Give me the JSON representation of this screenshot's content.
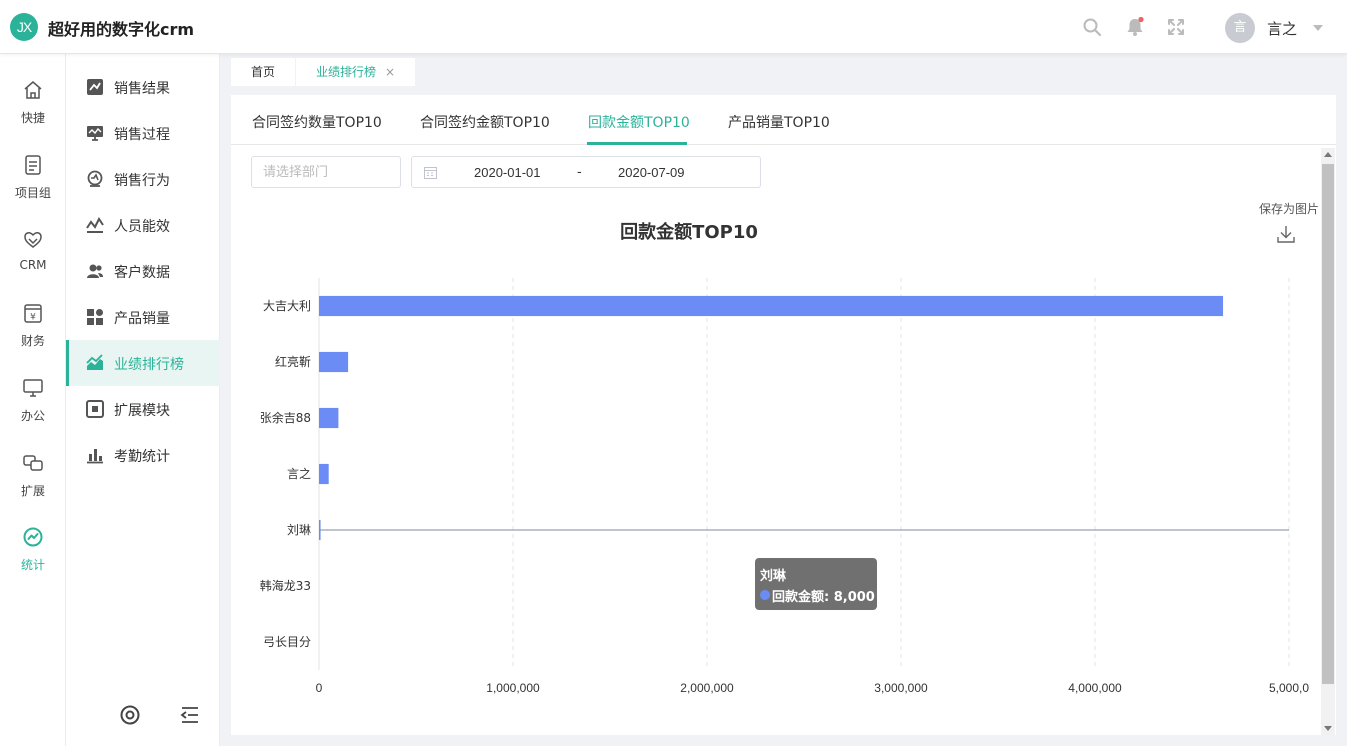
{
  "app": {
    "logo_text": "JX",
    "title": "超好用的数字化crm"
  },
  "header": {
    "icons": [
      "search-icon",
      "bell-icon",
      "fullscreen-icon"
    ],
    "avatar_text": "言",
    "user_name": "言之"
  },
  "rail": {
    "items": [
      {
        "label": "快捷",
        "icon": "home-icon"
      },
      {
        "label": "项目组",
        "icon": "document-icon"
      },
      {
        "label": "CRM",
        "icon": "handshake-icon"
      },
      {
        "label": "财务",
        "icon": "finance-icon"
      },
      {
        "label": "办公",
        "icon": "monitor-icon"
      },
      {
        "label": "扩展",
        "icon": "extension-icon"
      },
      {
        "label": "统计",
        "icon": "stats-icon",
        "active": true
      }
    ]
  },
  "subnav": {
    "items": [
      {
        "label": "销售结果",
        "icon": "sales-result-icon"
      },
      {
        "label": "销售过程",
        "icon": "sales-process-icon"
      },
      {
        "label": "销售行为",
        "icon": "sales-behavior-icon"
      },
      {
        "label": "人员能效",
        "icon": "efficiency-icon"
      },
      {
        "label": "客户数据",
        "icon": "customers-icon"
      },
      {
        "label": "产品销量",
        "icon": "products-icon"
      },
      {
        "label": "业绩排行榜",
        "icon": "ranking-icon",
        "active": true
      },
      {
        "label": "扩展模块",
        "icon": "module-icon"
      },
      {
        "label": "考勤统计",
        "icon": "attendance-icon"
      }
    ],
    "footer_icons": [
      "settings-icon",
      "collapse-menu-icon"
    ]
  },
  "tabs": [
    {
      "label": "首页"
    },
    {
      "label": "业绩排行榜",
      "active": true,
      "close": "×"
    }
  ],
  "content_tabs": [
    {
      "label": "合同签约数量TOP10"
    },
    {
      "label": "合同签约金额TOP10"
    },
    {
      "label": "回款金额TOP10",
      "active": true
    },
    {
      "label": "产品销量TOP10"
    }
  ],
  "filters": {
    "dept_placeholder": "请选择部门",
    "date_start": "2020-01-01",
    "date_sep": "-",
    "date_end": "2020-07-09"
  },
  "toolbox": {
    "save_label": "保存为图片"
  },
  "chart_data": {
    "type": "bar",
    "orientation": "horizontal",
    "title": "回款金额TOP10",
    "categories": [
      "大吉大利",
      "红亮靳",
      "张余吉88",
      "言之",
      "刘琳",
      "韩海龙33",
      "弓长目分"
    ],
    "series": [
      {
        "name": "回款金额",
        "values": [
          4660000,
          150000,
          100000,
          50000,
          8000,
          0,
          0
        ]
      }
    ],
    "x_ticks": [
      "0",
      "1,000,000",
      "2,000,000",
      "3,000,000",
      "4,000,000",
      "5,000,0"
    ],
    "xlim": [
      0,
      5000000
    ],
    "grid": true,
    "bar_color": "#6c8cf5"
  },
  "tooltip": {
    "title": "刘琳",
    "row": "回款金额: 8,000"
  }
}
